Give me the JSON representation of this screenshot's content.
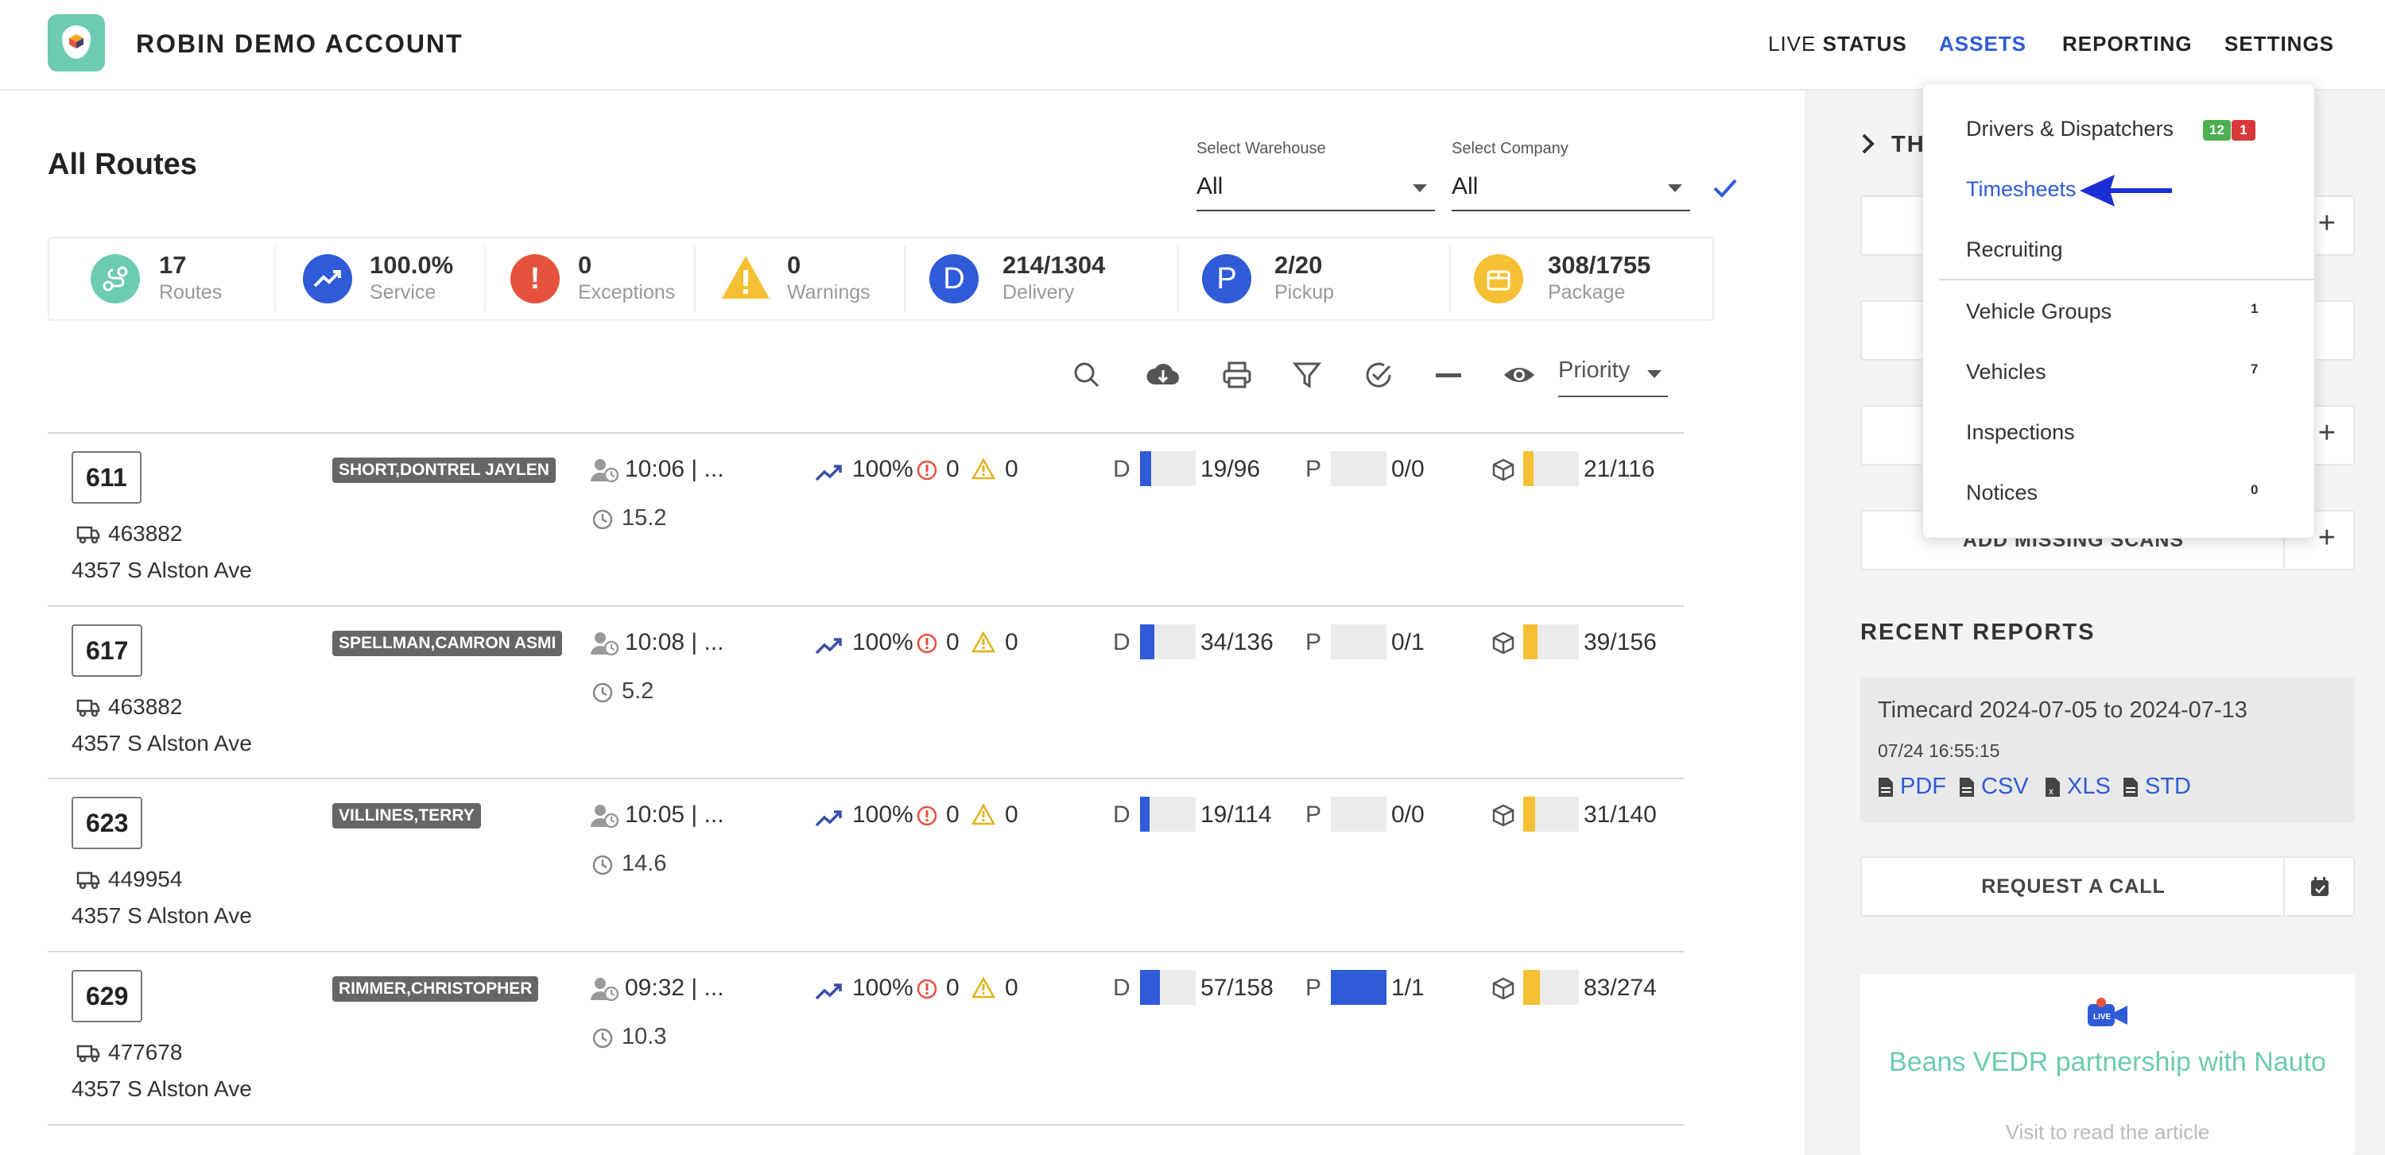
{
  "header": {
    "account_name": "ROBIN DEMO ACCOUNT",
    "nav": {
      "live_prefix": "LIVE",
      "live_suffix": "STATUS",
      "assets": "ASSETS",
      "reporting": "REPORTING",
      "settings": "SETTINGS"
    }
  },
  "main": {
    "title": "All Routes",
    "warehouse": {
      "label": "Select Warehouse",
      "value": "All"
    },
    "company": {
      "label": "Select Company",
      "value": "All"
    },
    "stats": [
      {
        "icon": "route-icon",
        "value": "17",
        "label": "Routes",
        "color": "#6ccbb0"
      },
      {
        "icon": "trend-up-icon",
        "value": "100.0%",
        "label": "Service",
        "color": "#2f5bd8"
      },
      {
        "icon": "exclamation-icon",
        "value": "0",
        "label": "Exceptions",
        "color": "#e5533d"
      },
      {
        "icon": "warning-icon",
        "value": "0",
        "label": "Warnings",
        "color": "#f5c033"
      },
      {
        "icon": "delivery-icon",
        "value": "214/1304",
        "label": "Delivery",
        "color": "#2f5bd8",
        "glyph": "D"
      },
      {
        "icon": "pickup-icon",
        "value": "2/20",
        "label": "Pickup",
        "color": "#2f5bd8",
        "glyph": "P"
      },
      {
        "icon": "package-icon",
        "value": "308/1755",
        "label": "Package",
        "color": "#f5c033"
      }
    ],
    "sort": {
      "value": "Priority"
    },
    "routes": [
      {
        "route": "611",
        "vehicle": "463882",
        "address": "4357 S Alston Ave",
        "driver": "SHORT,DONTREL JAYLEN",
        "start": "10:06 | ...",
        "duration": "15.2",
        "service": "100%",
        "exceptions": "0",
        "warnings": "0",
        "delivery_prefix": "D",
        "delivery": "19/96",
        "delivery_fraction": 0.198,
        "pickup_prefix": "P",
        "pickup": "0/0",
        "pickup_fraction": 0,
        "package": "21/116",
        "package_fraction": 0.181
      },
      {
        "route": "617",
        "vehicle": "463882",
        "address": "4357 S Alston Ave",
        "driver": "SPELLMAN,CAMRON ASMI",
        "start": "10:08 | ...",
        "duration": "5.2",
        "service": "100%",
        "exceptions": "0",
        "warnings": "0",
        "delivery_prefix": "D",
        "delivery": "34/136",
        "delivery_fraction": 0.25,
        "pickup_prefix": "P",
        "pickup": "0/1",
        "pickup_fraction": 0,
        "package": "39/156",
        "package_fraction": 0.25
      },
      {
        "route": "623",
        "vehicle": "449954",
        "address": "4357 S Alston Ave",
        "driver": "VILLINES,TERRY",
        "start": "10:05 | ...",
        "duration": "14.6",
        "service": "100%",
        "exceptions": "0",
        "warnings": "0",
        "delivery_prefix": "D",
        "delivery": "19/114",
        "delivery_fraction": 0.167,
        "pickup_prefix": "P",
        "pickup": "0/0",
        "pickup_fraction": 0,
        "package": "31/140",
        "package_fraction": 0.221
      },
      {
        "route": "629",
        "vehicle": "477678",
        "address": "4357 S Alston Ave",
        "driver": "RIMMER,CHRISTOPHER",
        "start": "09:32 | ...",
        "duration": "10.3",
        "service": "100%",
        "exceptions": "0",
        "warnings": "0",
        "delivery_prefix": "D",
        "delivery": "57/158",
        "delivery_fraction": 0.361,
        "pickup_prefix": "P",
        "pickup": "1/1",
        "pickup_fraction": 1,
        "package": "83/274",
        "package_fraction": 0.303
      }
    ]
  },
  "right_panel": {
    "section_fragment": "TH",
    "add_missing_scans": "ADD MISSING SCANS",
    "recent_reports_title": "RECENT REPORTS",
    "report": {
      "name": "Timecard 2024-07-05 to 2024-07-13",
      "time": "07/24 16:55:15",
      "formats": [
        "PDF",
        "CSV",
        "XLS",
        "STD"
      ]
    },
    "request_call": "REQUEST A CALL",
    "promo": {
      "title": "Beans VEDR partnership with Nauto",
      "subtitle": "Visit to read the article"
    }
  },
  "assets_menu": {
    "items": [
      {
        "label": "Drivers & Dispatchers",
        "badges": [
          "12",
          "1"
        ]
      },
      {
        "label": "Timesheets",
        "active": true
      },
      {
        "label": "Recruiting"
      },
      {
        "label": "Vehicle Groups",
        "count": "1"
      },
      {
        "label": "Vehicles",
        "count": "7"
      },
      {
        "label": "Inspections"
      },
      {
        "label": "Notices",
        "count": "0"
      }
    ]
  },
  "colors": {
    "accent": "#2f5bd8",
    "teal": "#6ccbb0",
    "danger": "#e5533d",
    "warning": "#f5c033",
    "badge_green": "#4caf50",
    "badge_red": "#d9383a"
  }
}
